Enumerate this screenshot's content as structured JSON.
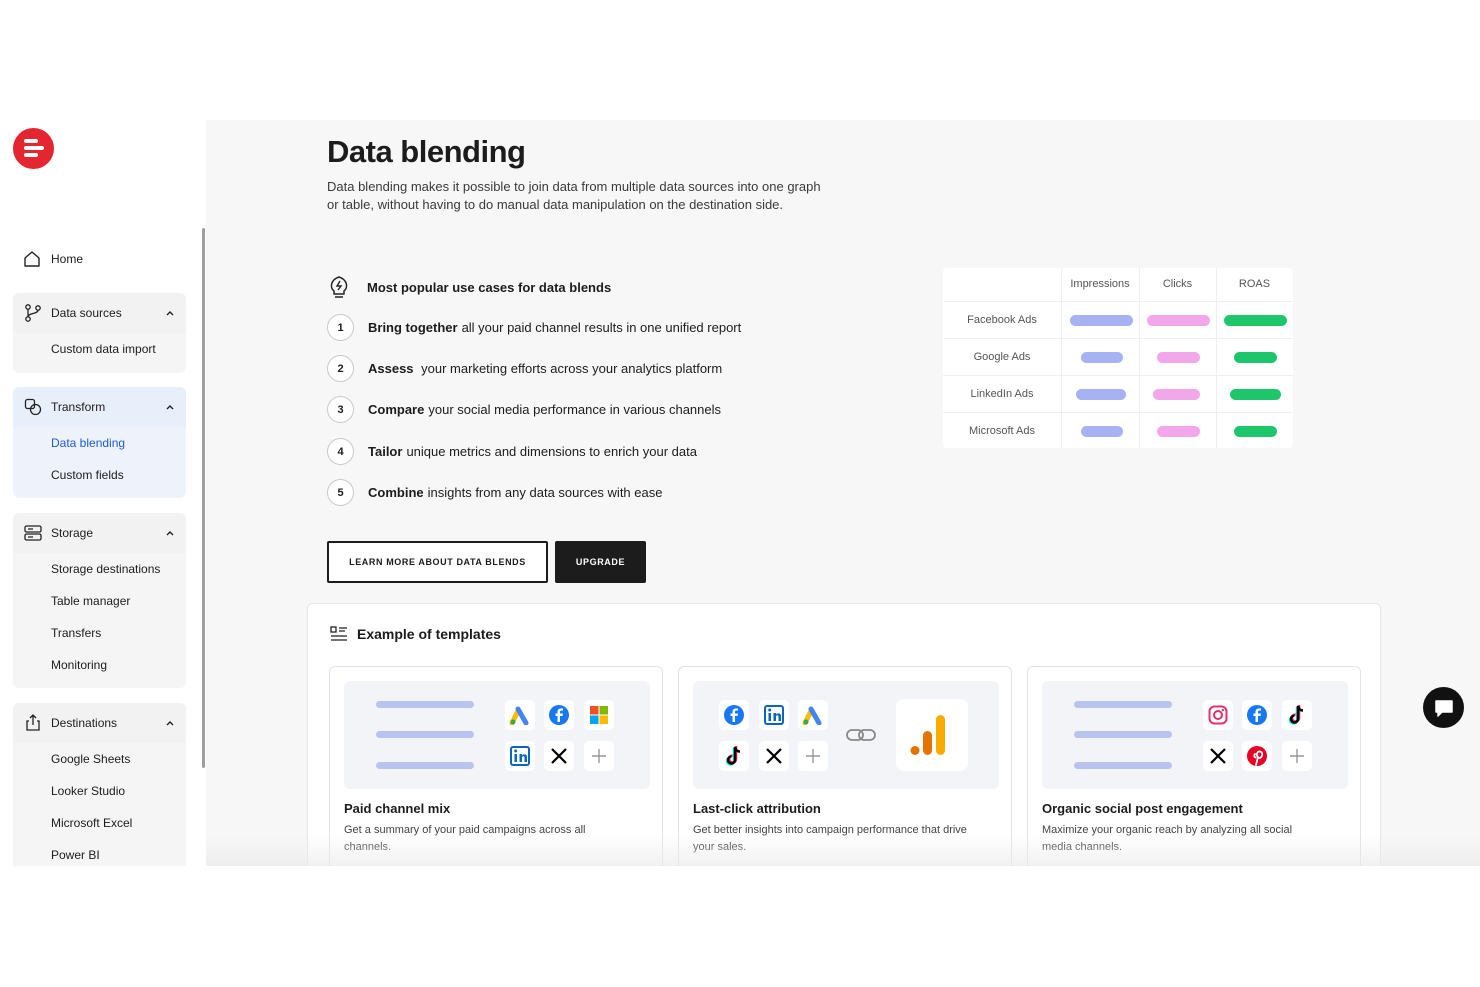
{
  "brand": {
    "accent": "#e3262f",
    "logo_icon": "logo-icon"
  },
  "sidebar": {
    "home": "Home",
    "groups": [
      {
        "label": "Data sources",
        "icon": "branch-icon",
        "items": [
          "Custom data import"
        ]
      },
      {
        "label": "Transform",
        "icon": "transform-icon",
        "items": [
          "Data blending",
          "Custom fields"
        ],
        "active_item": "Data blending"
      },
      {
        "label": "Storage",
        "icon": "storage-icon",
        "items": [
          "Storage destinations",
          "Table manager",
          "Transfers",
          "Monitoring"
        ]
      },
      {
        "label": "Destinations",
        "icon": "upload-icon",
        "items": [
          "Google Sheets",
          "Looker Studio",
          "Microsoft Excel",
          "Power BI"
        ]
      }
    ]
  },
  "main": {
    "title": "Data blending",
    "description": "Data blending makes it possible to join data from multiple data sources into one graph or table, without having to do manual data manipulation on the destination side.",
    "use_cases_heading": "Most popular use cases for data blends",
    "use_cases": [
      {
        "num": "1",
        "bold": "Bring together",
        "rest": "all your paid channel results in one unified report"
      },
      {
        "num": "2",
        "bold": "Assess",
        "rest": " your marketing efforts across your analytics platform"
      },
      {
        "num": "3",
        "bold": "Compare",
        "rest": "your social media performance in various channels"
      },
      {
        "num": "4",
        "bold": "Tailor",
        "rest": "unique metrics and dimensions to enrich your data"
      },
      {
        "num": "5",
        "bold": "Combine",
        "rest": "insights from any data sources with ease"
      }
    ],
    "learn_more_button": "LEARN MORE ABOUT DATA BLENDS",
    "upgrade_button": "UPGRADE",
    "metrics_table": {
      "columns": [
        "Impressions",
        "Clicks",
        "ROAS"
      ],
      "rows": [
        "Facebook Ads",
        "Google Ads",
        "LinkedIn Ads",
        "Microsoft Ads"
      ],
      "colors": {
        "impressions": "#a7b2f2",
        "clicks": "#f2a7ea",
        "roas": "#1ec66b"
      }
    },
    "templates": {
      "heading": "Example of templates",
      "cards": [
        {
          "title": "Paid channel mix",
          "description": "Get a summary of your paid campaigns across all channels.",
          "icons": [
            "google-ads-icon",
            "facebook-icon",
            "microsoft-icon",
            "linkedin-icon",
            "x-icon",
            "plus-icon"
          ]
        },
        {
          "title": "Last-click attribution",
          "description": "Get better insights into campaign performance that drive your sales.",
          "icons": [
            "facebook-icon",
            "linkedin-icon",
            "google-ads-icon",
            "tiktok-icon",
            "x-icon",
            "plus-icon",
            "link-icon",
            "google-analytics-icon"
          ]
        },
        {
          "title": "Organic social post engagement",
          "description": "Maximize your organic reach by analyzing all social media channels.",
          "icons": [
            "instagram-icon",
            "facebook-icon",
            "tiktok-icon",
            "x-icon",
            "pinterest-icon",
            "plus-icon"
          ]
        }
      ]
    }
  }
}
